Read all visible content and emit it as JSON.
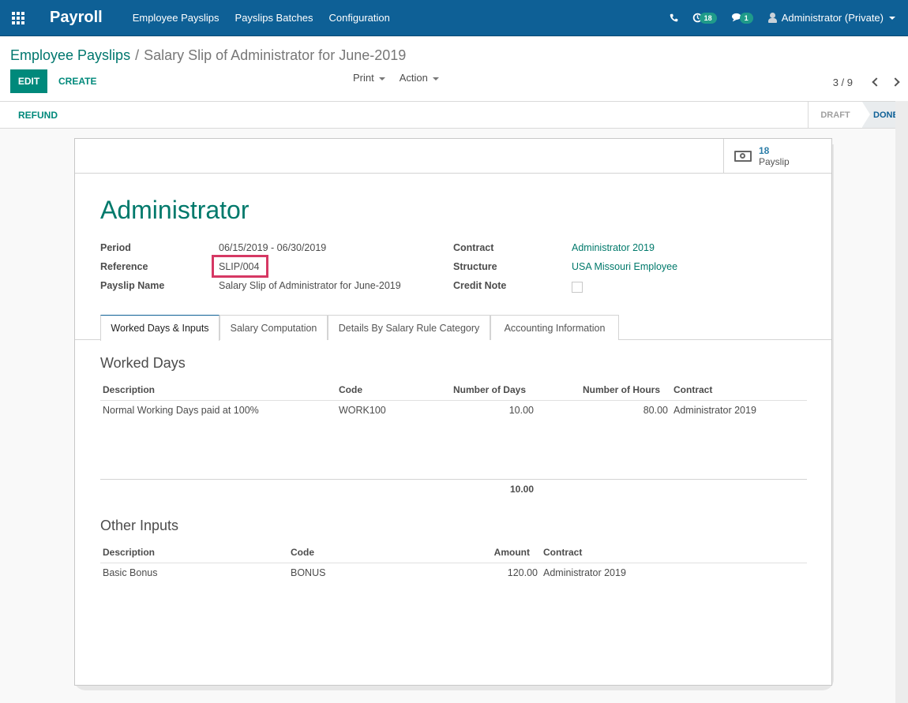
{
  "navbar": {
    "app_name": "Payroll",
    "menu": [
      "Employee Payslips",
      "Payslips Batches",
      "Configuration"
    ],
    "activity_count": "18",
    "messages_count": "1",
    "user": "Administrator (Private)",
    "bg_color": "#0e6096"
  },
  "breadcrumb": {
    "parent": "Employee Payslips",
    "current": "Salary Slip of Administrator for June-2019"
  },
  "toolbar": {
    "edit_label": "EDIT",
    "create_label": "CREATE",
    "print_label": "Print",
    "action_label": "Action",
    "pager": "3 / 9"
  },
  "statusbar": {
    "refund_label": "REFUND",
    "steps": [
      "DRAFT",
      "DONE"
    ],
    "active_step": "DONE"
  },
  "stat_button": {
    "value": "18",
    "label": "Payslip"
  },
  "form": {
    "employee": "Administrator",
    "fields_left": [
      {
        "label": "Period",
        "value": "06/15/2019 - 06/30/2019"
      },
      {
        "label": "Reference",
        "value": "SLIP/004"
      },
      {
        "label": "Payslip Name",
        "value": "Salary Slip of Administrator for June-2019"
      }
    ],
    "fields_right": [
      {
        "label": "Contract",
        "value": "Administrator 2019"
      },
      {
        "label": "Structure",
        "value": "USA Missouri Employee"
      },
      {
        "label": "Credit Note",
        "value": false
      }
    ]
  },
  "tabs": [
    "Worked Days & Inputs",
    "Salary Computation",
    "Details By Salary Rule Category",
    "Accounting Information"
  ],
  "active_tab": "Worked Days & Inputs",
  "worked_days": {
    "title": "Worked Days",
    "columns": [
      "Description",
      "Code",
      "Number of Days",
      "Number of Hours",
      "Contract"
    ],
    "rows": [
      [
        "Normal Working Days paid at 100%",
        "WORK100",
        "10.00",
        "80.00",
        "Administrator 2019"
      ]
    ],
    "total_days": "10.00"
  },
  "other_inputs": {
    "title": "Other Inputs",
    "columns": [
      "Description",
      "Code",
      "Amount",
      "Contract"
    ],
    "rows": [
      [
        "Basic Bonus",
        "BONUS",
        "120.00",
        "Administrator 2019"
      ]
    ]
  }
}
